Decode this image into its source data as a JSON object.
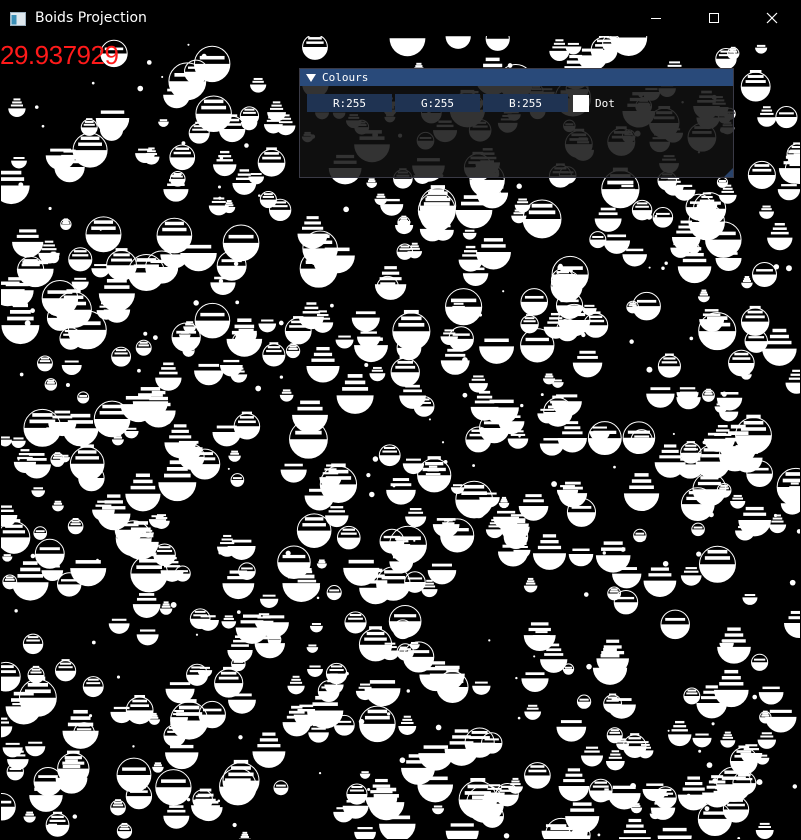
{
  "window": {
    "title": "Boids Projection",
    "icon": "app-window-icon",
    "buttons": [
      "minimize-icon",
      "maximize-icon",
      "close-icon"
    ]
  },
  "overlay": {
    "fps_text": "29.937929",
    "fps_color": "#ff1a1a"
  },
  "panel": {
    "title": "Colours",
    "expanded": true,
    "fields": [
      {
        "label": "R:255"
      },
      {
        "label": "G:255"
      },
      {
        "label": "B:255"
      }
    ],
    "swatch_color": "#ffffff",
    "shape_label": "Dot",
    "title_color": "#294a7a",
    "field_color": "#1f3352"
  },
  "scene": {
    "background": "#000000",
    "boid_color": "#ffffff"
  }
}
